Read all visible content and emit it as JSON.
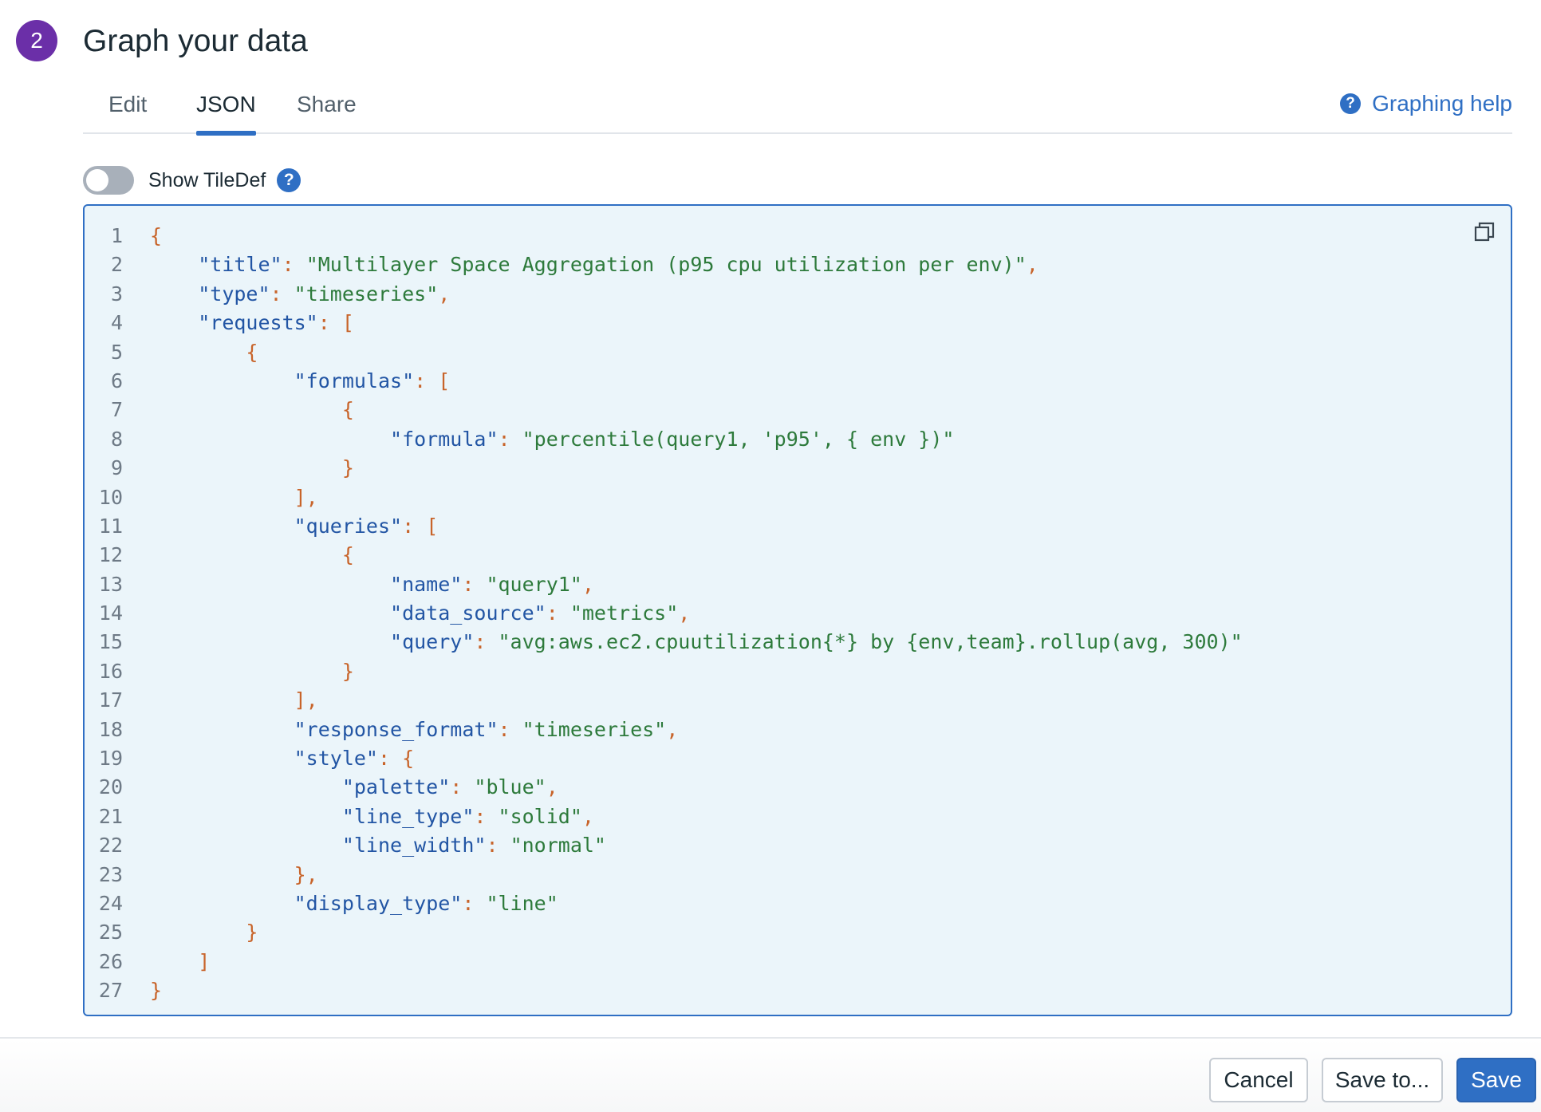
{
  "header": {
    "step_number": "2",
    "title": "Graph your data"
  },
  "tabs": [
    {
      "label": "Edit",
      "active": false
    },
    {
      "label": "JSON",
      "active": true
    },
    {
      "label": "Share",
      "active": false
    }
  ],
  "help": {
    "label": "Graphing help",
    "icon": "question-circle-icon"
  },
  "tiledef": {
    "label": "Show TileDef",
    "enabled": false,
    "icon": "question-circle-icon"
  },
  "editor": {
    "copy_icon": "copy-icon",
    "colors": {
      "key": "#2255a4",
      "string": "#2d7a3b",
      "punctuation": "#c8642a",
      "border": "#2f6fc4",
      "background": "#ebf5fa"
    },
    "lines": [
      {
        "n": "1",
        "indent": 0,
        "tokens": [
          [
            "p",
            "{"
          ]
        ]
      },
      {
        "n": "2",
        "indent": 1,
        "tokens": [
          [
            "k",
            "\"title\""
          ],
          [
            "p",
            ": "
          ],
          [
            "s",
            "\"Multilayer Space Aggregation (p95 cpu utilization per env)\""
          ],
          [
            "p",
            ","
          ]
        ]
      },
      {
        "n": "3",
        "indent": 1,
        "tokens": [
          [
            "k",
            "\"type\""
          ],
          [
            "p",
            ": "
          ],
          [
            "s",
            "\"timeseries\""
          ],
          [
            "p",
            ","
          ]
        ]
      },
      {
        "n": "4",
        "indent": 1,
        "tokens": [
          [
            "k",
            "\"requests\""
          ],
          [
            "p",
            ": ["
          ]
        ]
      },
      {
        "n": "5",
        "indent": 2,
        "tokens": [
          [
            "p",
            "{"
          ]
        ]
      },
      {
        "n": "6",
        "indent": 3,
        "tokens": [
          [
            "k",
            "\"formulas\""
          ],
          [
            "p",
            ": ["
          ]
        ]
      },
      {
        "n": "7",
        "indent": 4,
        "tokens": [
          [
            "p",
            "{"
          ]
        ]
      },
      {
        "n": "8",
        "indent": 5,
        "tokens": [
          [
            "k",
            "\"formula\""
          ],
          [
            "p",
            ": "
          ],
          [
            "s",
            "\"percentile(query1, 'p95', { env })\""
          ]
        ]
      },
      {
        "n": "9",
        "indent": 4,
        "tokens": [
          [
            "p",
            "}"
          ]
        ]
      },
      {
        "n": "10",
        "indent": 3,
        "tokens": [
          [
            "p",
            "],"
          ]
        ]
      },
      {
        "n": "11",
        "indent": 3,
        "tokens": [
          [
            "k",
            "\"queries\""
          ],
          [
            "p",
            ": ["
          ]
        ]
      },
      {
        "n": "12",
        "indent": 4,
        "tokens": [
          [
            "p",
            "{"
          ]
        ]
      },
      {
        "n": "13",
        "indent": 5,
        "tokens": [
          [
            "k",
            "\"name\""
          ],
          [
            "p",
            ": "
          ],
          [
            "s",
            "\"query1\""
          ],
          [
            "p",
            ","
          ]
        ]
      },
      {
        "n": "14",
        "indent": 5,
        "tokens": [
          [
            "k",
            "\"data_source\""
          ],
          [
            "p",
            ": "
          ],
          [
            "s",
            "\"metrics\""
          ],
          [
            "p",
            ","
          ]
        ]
      },
      {
        "n": "15",
        "indent": 5,
        "tokens": [
          [
            "k",
            "\"query\""
          ],
          [
            "p",
            ": "
          ],
          [
            "s",
            "\"avg:aws.ec2.cpuutilization{*} by {env,team}.rollup(avg, 300)\""
          ]
        ]
      },
      {
        "n": "16",
        "indent": 4,
        "tokens": [
          [
            "p",
            "}"
          ]
        ]
      },
      {
        "n": "17",
        "indent": 3,
        "tokens": [
          [
            "p",
            "],"
          ]
        ]
      },
      {
        "n": "18",
        "indent": 3,
        "tokens": [
          [
            "k",
            "\"response_format\""
          ],
          [
            "p",
            ": "
          ],
          [
            "s",
            "\"timeseries\""
          ],
          [
            "p",
            ","
          ]
        ]
      },
      {
        "n": "19",
        "indent": 3,
        "tokens": [
          [
            "k",
            "\"style\""
          ],
          [
            "p",
            ": {"
          ]
        ]
      },
      {
        "n": "20",
        "indent": 4,
        "tokens": [
          [
            "k",
            "\"palette\""
          ],
          [
            "p",
            ": "
          ],
          [
            "s",
            "\"blue\""
          ],
          [
            "p",
            ","
          ]
        ]
      },
      {
        "n": "21",
        "indent": 4,
        "tokens": [
          [
            "k",
            "\"line_type\""
          ],
          [
            "p",
            ": "
          ],
          [
            "s",
            "\"solid\""
          ],
          [
            "p",
            ","
          ]
        ]
      },
      {
        "n": "22",
        "indent": 4,
        "tokens": [
          [
            "k",
            "\"line_width\""
          ],
          [
            "p",
            ": "
          ],
          [
            "s",
            "\"normal\""
          ]
        ]
      },
      {
        "n": "23",
        "indent": 3,
        "tokens": [
          [
            "p",
            "},"
          ]
        ]
      },
      {
        "n": "24",
        "indent": 3,
        "tokens": [
          [
            "k",
            "\"display_type\""
          ],
          [
            "p",
            ": "
          ],
          [
            "s",
            "\"line\""
          ]
        ]
      },
      {
        "n": "25",
        "indent": 2,
        "tokens": [
          [
            "p",
            "}"
          ]
        ]
      },
      {
        "n": "26",
        "indent": 1,
        "tokens": [
          [
            "p",
            "]"
          ]
        ]
      },
      {
        "n": "27",
        "indent": 0,
        "tokens": [
          [
            "p",
            "}"
          ]
        ]
      }
    ]
  },
  "footer": {
    "cancel_label": "Cancel",
    "save_to_label": "Save to...",
    "save_label": "Save"
  }
}
